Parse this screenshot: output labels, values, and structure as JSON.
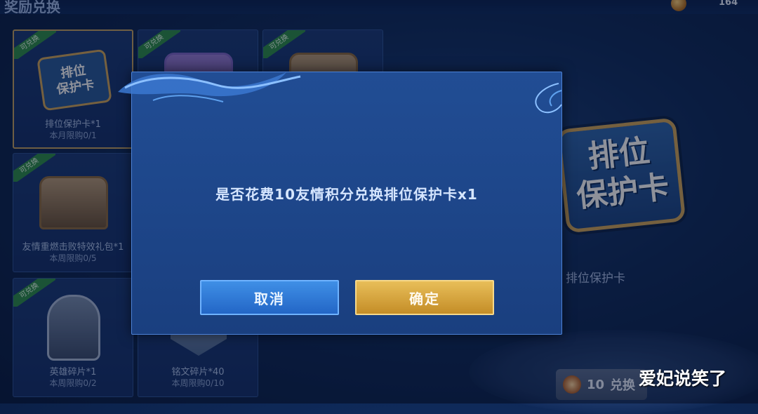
{
  "header": {
    "title": "奖励兑换",
    "coin_count": "164"
  },
  "items": [
    {
      "badge": "可兑换",
      "art_text": "排位\n保护卡",
      "name": "排位保护卡*1",
      "limit": "本月限购0/1"
    },
    {
      "badge": "可兑换",
      "name": "",
      "limit": ""
    },
    {
      "badge": "可兑换",
      "name": "",
      "limit": ""
    },
    {
      "badge": "可兑换",
      "name": "友情重燃击败特效礼包*1",
      "limit": "本周限购0/5"
    },
    {
      "badge": "可兑换",
      "name": "英雄碎片*1",
      "limit": "本周限购0/2"
    },
    {
      "badge": "",
      "name": "铭文碎片*40",
      "limit": "本周限购0/10"
    }
  ],
  "preview": {
    "card_text": "排位\n保护卡",
    "label": "排位保护卡"
  },
  "exchange_button": {
    "cost": "10",
    "label": "兑换"
  },
  "dialog": {
    "message": "是否花费10友情积分兑换排位保护卡x1",
    "cancel_label": "取消",
    "confirm_label": "确定"
  },
  "watermark": "爱妃说笑了",
  "colors": {
    "cancel_button": "#2f7bd8",
    "confirm_button": "#d9a63f",
    "dialog_bg": "#1f4a8f",
    "badge_green": "#2f8f4a"
  }
}
